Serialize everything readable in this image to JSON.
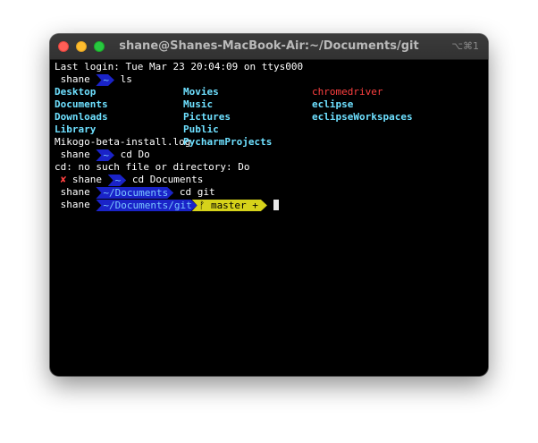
{
  "window": {
    "title": "shane@Shanes-MacBook-Air:~/Documents/git",
    "shortcut": "⌥⌘1"
  },
  "terminal": {
    "last_login": "Last login: Tue Mar 23 20:04:09 on ttys000",
    "prompt_user": "shane",
    "home_dir": "~",
    "cmd_ls": "ls",
    "ls_rows": [
      [
        "Desktop",
        "Movies",
        "chromedriver"
      ],
      [
        "Documents",
        "Music",
        "eclipse"
      ],
      [
        "Downloads",
        "Pictures",
        "eclipseWorkspaces"
      ],
      [
        "Library",
        "Public",
        ""
      ],
      [
        "Mikogo-beta-install.log",
        "PycharmProjects",
        ""
      ]
    ],
    "cmd_cd_do": "cd Do",
    "error_line": "cd: no such file or directory: Do",
    "error_mark": "✘",
    "cmd_cd_documents": "cd Documents",
    "dir_documents": "~/Documents",
    "cmd_cd_git": "cd git",
    "dir_git": "~/Documents/git",
    "git_branch": "ᚠ master +"
  },
  "colors": {
    "background": "#000000",
    "directory": "#6ee0ff",
    "executable": "#ff4040",
    "prompt_dir_bg": "#1a23c8",
    "git_segment_bg": "#d6d21a"
  }
}
